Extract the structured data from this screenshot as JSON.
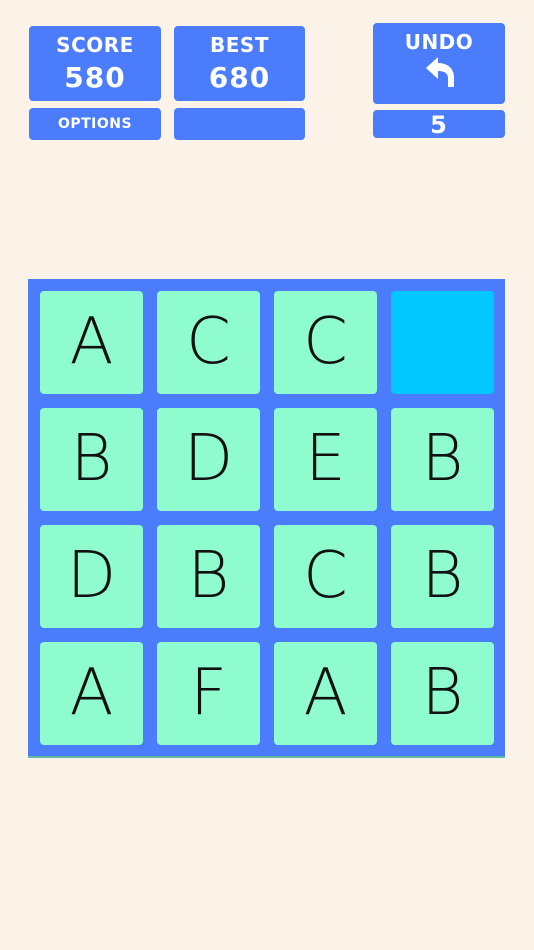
{
  "score": {
    "label": "SCORE",
    "value": "580"
  },
  "best": {
    "label": "BEST",
    "value": "680"
  },
  "options": {
    "label": "OPTIONS"
  },
  "undo": {
    "label": "UNDO",
    "count": "5",
    "icon": "undo-arrow-icon"
  },
  "colors": {
    "background": "#fcf3e8",
    "panel": "#4a7cfb",
    "tile": "#8ffccf",
    "empty_tile": "#00c8ff"
  },
  "board": {
    "rows": [
      [
        "A",
        "C",
        "C",
        ""
      ],
      [
        "B",
        "D",
        "E",
        "B"
      ],
      [
        "D",
        "B",
        "C",
        "B"
      ],
      [
        "A",
        "F",
        "A",
        "B"
      ]
    ]
  }
}
